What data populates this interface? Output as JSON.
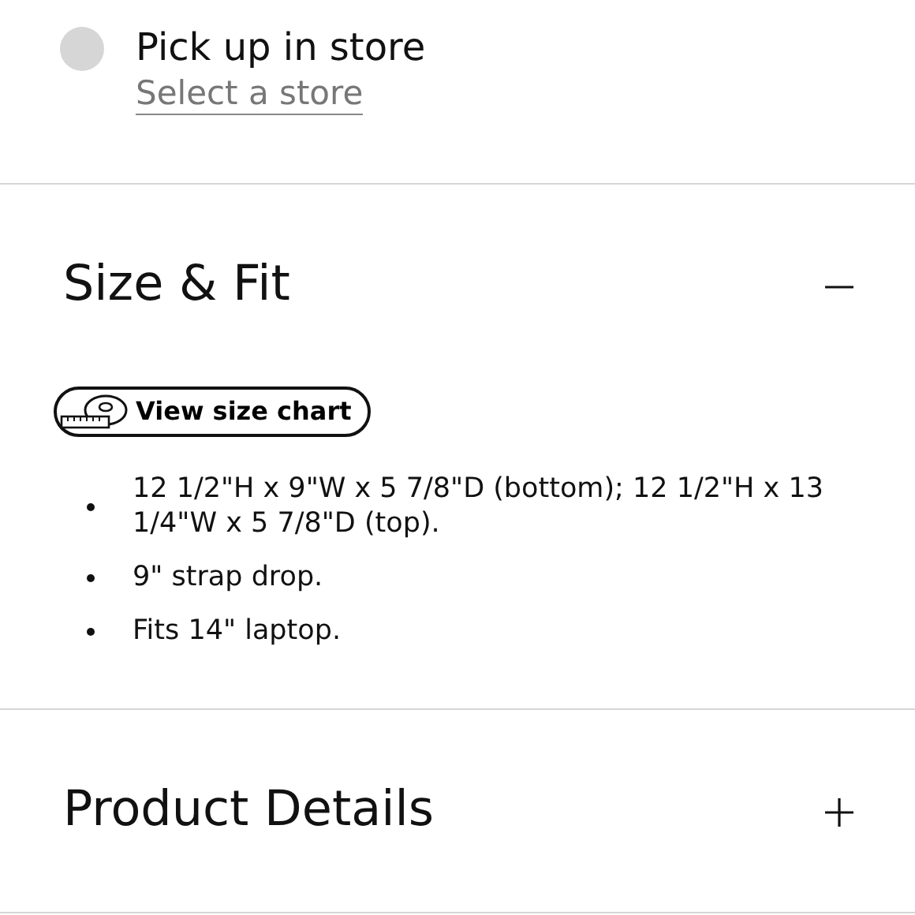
{
  "pickup": {
    "label": "Pick up in store",
    "selected": false,
    "link": "Select a store"
  },
  "sections": [
    {
      "title": "Size & Fit",
      "expanded": true,
      "button": "View size chart",
      "bullets": [
        "12 1/2\"H x 9\"W x 5 7/8\"D (bottom); 12 1/2\"H x 13 1/4\"W x 5 7/8\"D (top).",
        "9\" strap drop.",
        "Fits 14\" laptop."
      ]
    },
    {
      "title": "Product Details",
      "expanded": false
    }
  ]
}
